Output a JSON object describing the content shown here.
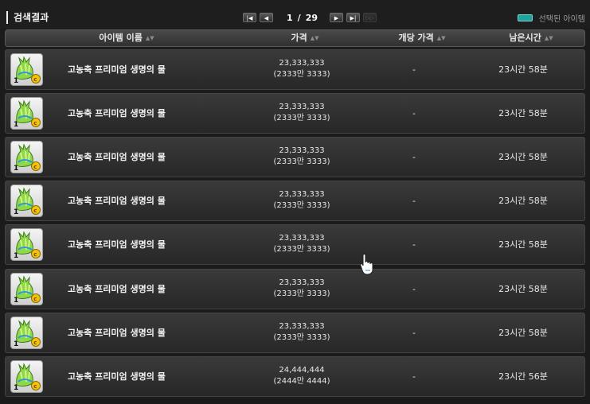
{
  "title": "검색결과",
  "pager": {
    "first": "|◀",
    "prev": "◀",
    "current": "1",
    "separator": "/",
    "total": "29",
    "next": "▶",
    "last": "▶|",
    "end": "▷▷"
  },
  "legend": {
    "label": "선택된 아이템",
    "color": "#1fa39c"
  },
  "columns": {
    "name": "아이템 이름",
    "price": "가격",
    "unit_price": "개당 가격",
    "remaining": "남은시간"
  },
  "sort_icon": "sort-arrows-icon",
  "rows": [
    {
      "name": "고농축 프리미엄 생명의 물",
      "price": "23,333,333",
      "price_kr": "(2333만 3333)",
      "unit_price": "-",
      "remaining": "23시간 58분"
    },
    {
      "name": "고농축 프리미엄 생명의 물",
      "price": "23,333,333",
      "price_kr": "(2333만 3333)",
      "unit_price": "-",
      "remaining": "23시간 58분"
    },
    {
      "name": "고농축 프리미엄 생명의 물",
      "price": "23,333,333",
      "price_kr": "(2333만 3333)",
      "unit_price": "-",
      "remaining": "23시간 58분"
    },
    {
      "name": "고농축 프리미엄 생명의 물",
      "price": "23,333,333",
      "price_kr": "(2333만 3333)",
      "unit_price": "-",
      "remaining": "23시간 58분"
    },
    {
      "name": "고농축 프리미엄 생명의 물",
      "price": "23,333,333",
      "price_kr": "(2333만 3333)",
      "unit_price": "-",
      "remaining": "23시간 58분"
    },
    {
      "name": "고농축 프리미엄 생명의 물",
      "price": "23,333,333",
      "price_kr": "(2333만 3333)",
      "unit_price": "-",
      "remaining": "23시간 58분"
    },
    {
      "name": "고농축 프리미엄 생명의 물",
      "price": "23,333,333",
      "price_kr": "(2333만 3333)",
      "unit_price": "-",
      "remaining": "23시간 58분"
    },
    {
      "name": "고농축 프리미엄 생명의 물",
      "price": "24,444,444",
      "price_kr": "(2444만 4444)",
      "unit_price": "-",
      "remaining": "23시간 56분"
    }
  ]
}
